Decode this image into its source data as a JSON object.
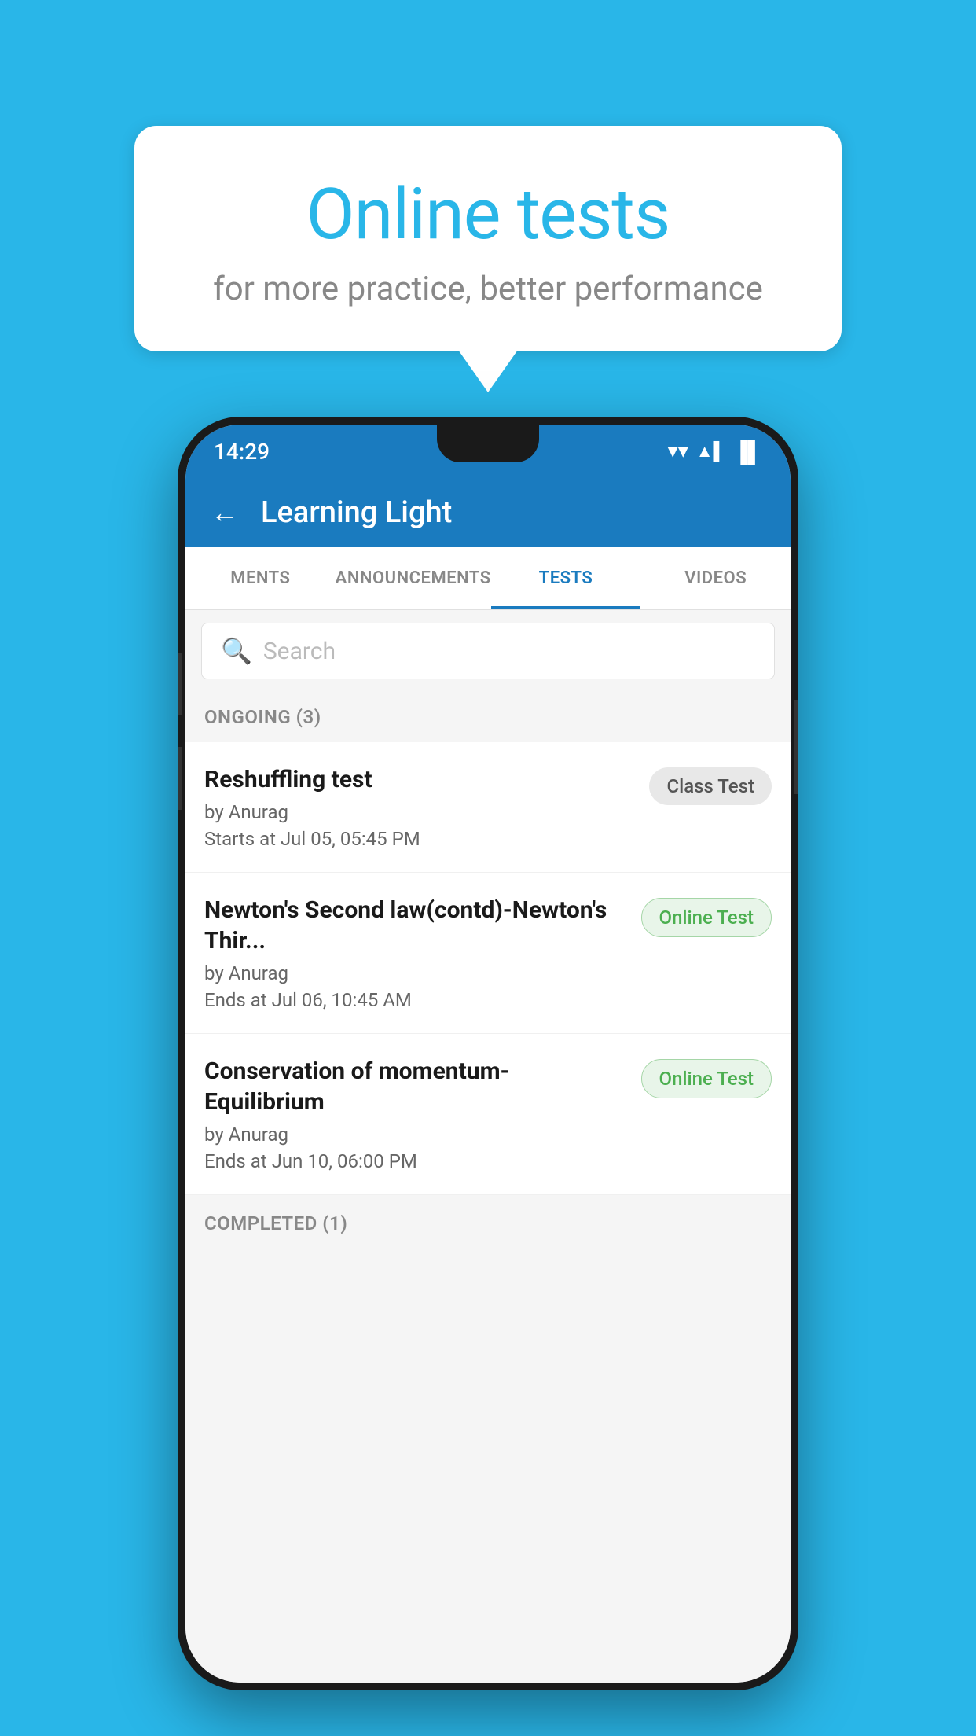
{
  "background": {
    "color": "#29b6e8"
  },
  "speech_bubble": {
    "title": "Online tests",
    "subtitle": "for more practice, better performance"
  },
  "phone": {
    "status_bar": {
      "time": "14:29",
      "wifi": "▲",
      "signal": "▲",
      "battery": "▐"
    },
    "app_bar": {
      "back_label": "←",
      "title": "Learning Light"
    },
    "tabs": [
      {
        "label": "MENTS",
        "active": false
      },
      {
        "label": "ANNOUNCEMENTS",
        "active": false
      },
      {
        "label": "TESTS",
        "active": true
      },
      {
        "label": "VIDEOS",
        "active": false
      }
    ],
    "search": {
      "placeholder": "Search"
    },
    "ongoing_section": {
      "title": "ONGOING (3)"
    },
    "test_items": [
      {
        "name": "Reshuffling test",
        "author": "by Anurag",
        "date_label": "Starts at",
        "date": "Jul 05, 05:45 PM",
        "badge": "Class Test",
        "badge_type": "class"
      },
      {
        "name": "Newton's Second law(contd)-Newton's Thir...",
        "author": "by Anurag",
        "date_label": "Ends at",
        "date": "Jul 06, 10:45 AM",
        "badge": "Online Test",
        "badge_type": "online"
      },
      {
        "name": "Conservation of momentum-Equilibrium",
        "author": "by Anurag",
        "date_label": "Ends at",
        "date": "Jun 10, 06:00 PM",
        "badge": "Online Test",
        "badge_type": "online"
      }
    ],
    "completed_section": {
      "title": "COMPLETED (1)"
    }
  }
}
